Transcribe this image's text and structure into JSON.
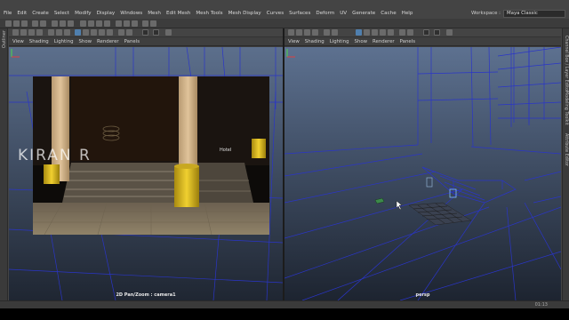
{
  "menu": [
    "File",
    "Edit",
    "Create",
    "Select",
    "Modify",
    "Display",
    "Windows",
    "Mesh",
    "Edit Mesh",
    "Mesh Tools",
    "Mesh Display",
    "Curves",
    "Surfaces",
    "Deform",
    "UV",
    "Generate",
    "Cache",
    "Help"
  ],
  "workspace": {
    "label": "Workspace :",
    "value": "Maya Classic"
  },
  "left_side_label": "Outliner",
  "right_side_labels": [
    "Channel Box / Layer Editor",
    "Modeling Toolkit",
    "Attribute Editor"
  ],
  "panel_menu": [
    "View",
    "Shading",
    "Lighting",
    "Show",
    "Renderer",
    "Panels"
  ],
  "left_panel": {
    "camera_label": "2D Pan/Zoom : camera1",
    "image_text": "Hotel"
  },
  "right_panel": {
    "camera_label": "persp"
  },
  "watermark": "KIRAN R",
  "bottom_value": "01:13",
  "colors": {
    "bg": "#444444",
    "viewport_top": "#5b6f8d",
    "viewport_bottom": "#1e2530",
    "grid": "#2a35c8",
    "selected": "#4f7fae"
  }
}
